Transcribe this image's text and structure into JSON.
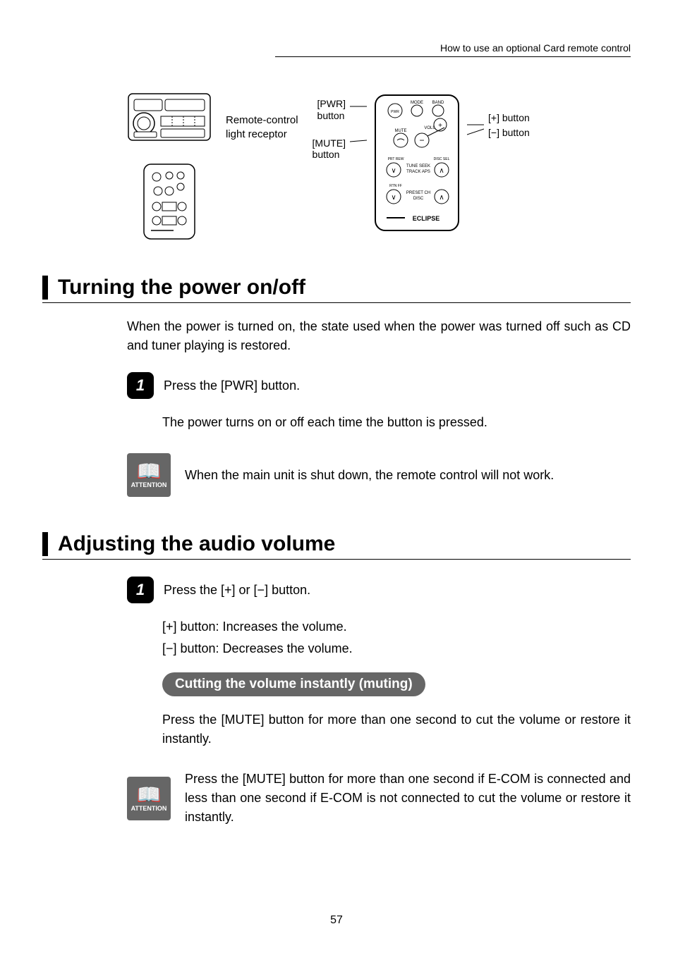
{
  "header": {
    "chapter": "How to use an optional Card remote control"
  },
  "diagram": {
    "receptor_label1": "Remote-control",
    "receptor_label2": "light receptor",
    "pwr_label1": "[PWR]",
    "pwr_label2": "button",
    "mute_label1": "[MUTE]",
    "mute_label2": "button",
    "plus_label": "[+] button",
    "minus_label": "[−] button",
    "remote_btn_mode": "MODE",
    "remote_btn_band": "BAND",
    "remote_btn_pwr": "PWR",
    "remote_btn_mute": "MUTE",
    "remote_btn_volume": "VOLUME",
    "remote_btn_tune_seek": "TUNE SEEK",
    "remote_btn_track_aps": "TRACK APS",
    "remote_btn_prt_rew": "PRT    REW",
    "remote_btn_disc_select": "DISC  SEL",
    "remote_btn_preset_ch": "PRESET CH",
    "remote_btn_disc": "DISC",
    "remote_btn_rtn_ff": "RTN    FF",
    "remote_brand": "ECLIPSE"
  },
  "sections": {
    "power": {
      "title": "Turning the power on/off",
      "intro": "When the power is turned on, the state used when the power was turned off such as CD and tuner playing is restored.",
      "step1_num": "1",
      "step1_text": "Press the [PWR] button.",
      "step1_desc": "The power turns on or off each time the button is pressed.",
      "attention_label": "ATTENTION",
      "attention_text": "When the main unit is shut down, the remote control will not work."
    },
    "volume": {
      "title": "Adjusting the audio volume",
      "step1_num": "1",
      "step1_text": "Press the [+] or [−] button.",
      "plus_line": "[+] button: Increases the volume.",
      "minus_line": "[−] button: Decreases the volume.",
      "pill": "Cutting the volume instantly (muting)",
      "pill_desc": "Press the [MUTE] button for more than one second to cut the volume or restore it instantly.",
      "attention_label": "ATTENTION",
      "attention_text": "Press the [MUTE] button for more than one second if E-COM is connected and less than one second if E-COM is not connected to cut the volume or restore it instantly."
    }
  },
  "page_number": "57"
}
